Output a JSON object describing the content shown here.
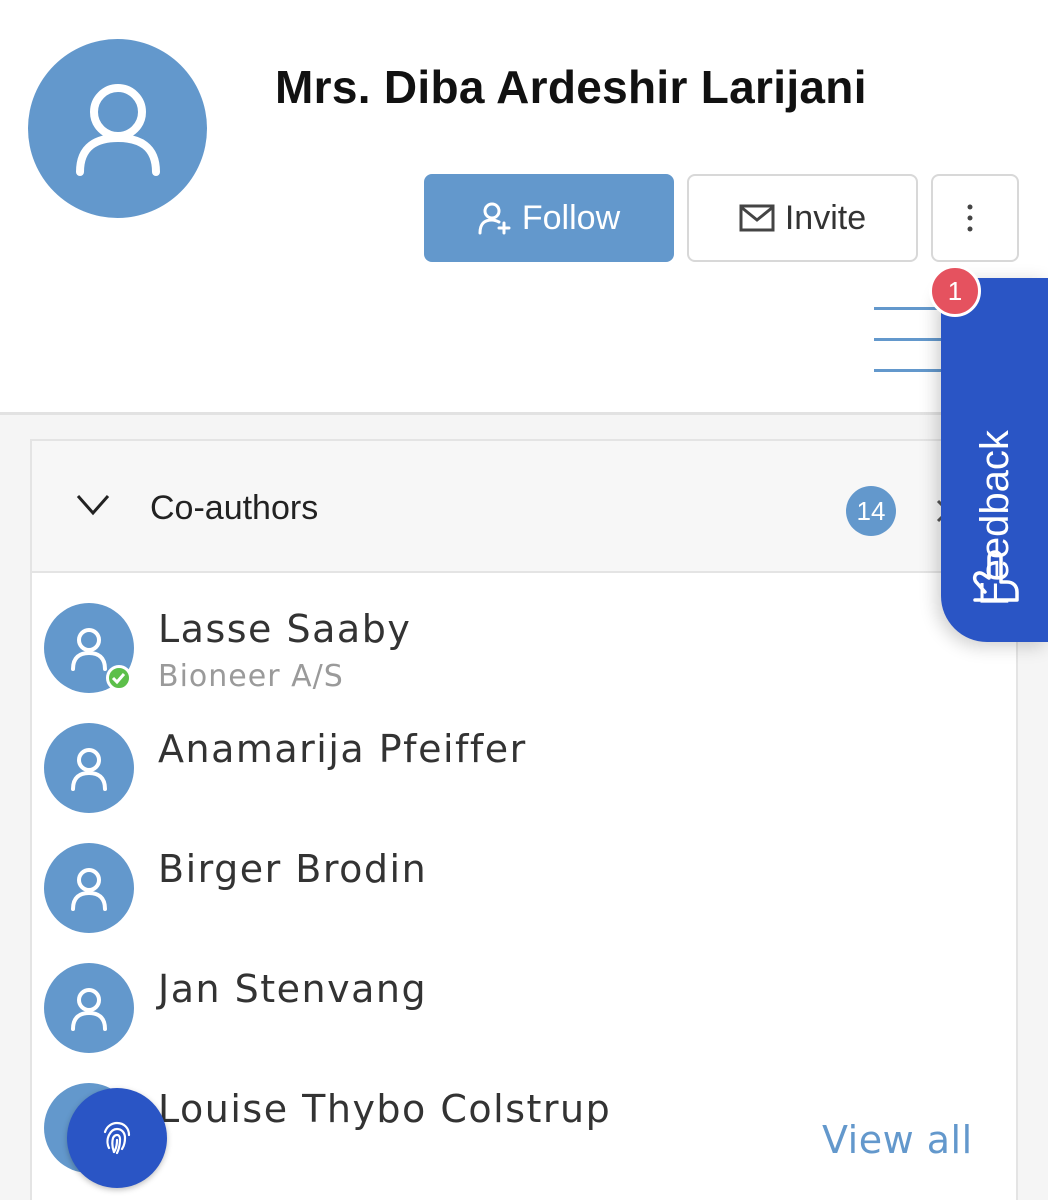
{
  "profile": {
    "name": "Mrs. Diba Ardeshir Larijani",
    "avatar_icon": "person-icon"
  },
  "actions": {
    "follow_label": "Follow",
    "invite_label": "Invite",
    "more_icon": "vertical-dots-icon"
  },
  "coauthors": {
    "title": "Co-authors",
    "count": "14",
    "items": [
      {
        "name": "Lasse Saaby",
        "affiliation": "Bioneer A/S",
        "verified": true
      },
      {
        "name": "Anamarija Pfeiffer",
        "affiliation": ""
      },
      {
        "name": "Birger Brodin",
        "affiliation": ""
      },
      {
        "name": "Jan Stenvang",
        "affiliation": ""
      },
      {
        "name": "Louise Thybo Colstrup",
        "affiliation": ""
      }
    ],
    "view_all_label": "View all"
  },
  "feedback": {
    "label": "Feedback",
    "badge_count": "1"
  },
  "colors": {
    "accent": "#6398cc",
    "feedback_blue": "#2a55c5",
    "badge_red": "#e5525f",
    "verified_green": "#5cbf4a"
  }
}
